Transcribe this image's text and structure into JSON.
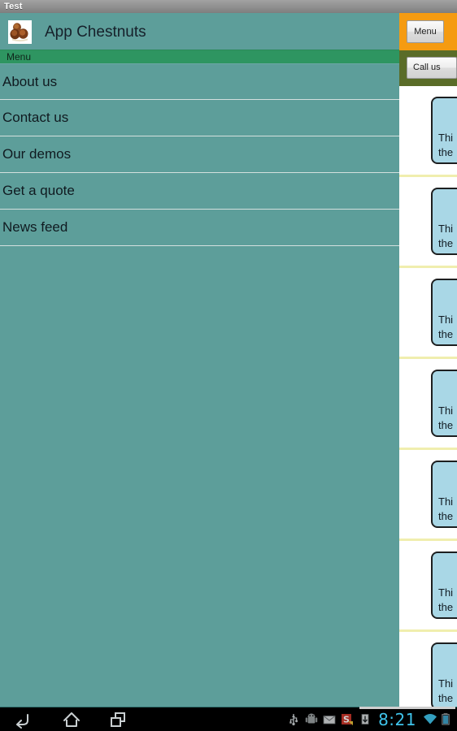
{
  "window": {
    "title": "Test"
  },
  "app": {
    "title": "App Chestnuts",
    "logo_icon": "chestnuts-logo-icon",
    "menu_bar_label": "Menu",
    "menu_items": [
      {
        "label": "About us"
      },
      {
        "label": "Contact us"
      },
      {
        "label": "Our demos"
      },
      {
        "label": "Get a quote"
      },
      {
        "label": "News feed"
      }
    ]
  },
  "right_panel": {
    "menu_button_label": "Menu",
    "call_button_label": "Call us",
    "topbar_color": "#f59b11",
    "subbar_color": "#5a6c28",
    "divider_color": "#f0eeae",
    "bubble_fill_color": "#a9d7e6",
    "feed_items": [
      {
        "text": "Thi\nthe"
      },
      {
        "text": "Thi\nthe"
      },
      {
        "text": "Thi\nthe"
      },
      {
        "text": "Thi\nthe"
      },
      {
        "text": "Thi\nthe"
      },
      {
        "text": "Thi\nthe"
      },
      {
        "text": "Thi\nthe"
      }
    ]
  },
  "navbar": {
    "back_icon": "back-arrow-icon",
    "home_icon": "home-icon",
    "recent_icon": "recent-apps-icon",
    "status_icons": [
      "usb-icon",
      "android-debug-icon",
      "email-icon",
      "s-app-icon",
      "download-icon"
    ],
    "clock": "8:21",
    "wifi_icon": "wifi-icon",
    "battery_icon": "battery-icon"
  },
  "theme": {
    "teal": "#5d9e9a",
    "green_bar": "#2e9561",
    "titlebar_gray": "#8f8f8f",
    "clock_blue": "#3fc3ea"
  }
}
